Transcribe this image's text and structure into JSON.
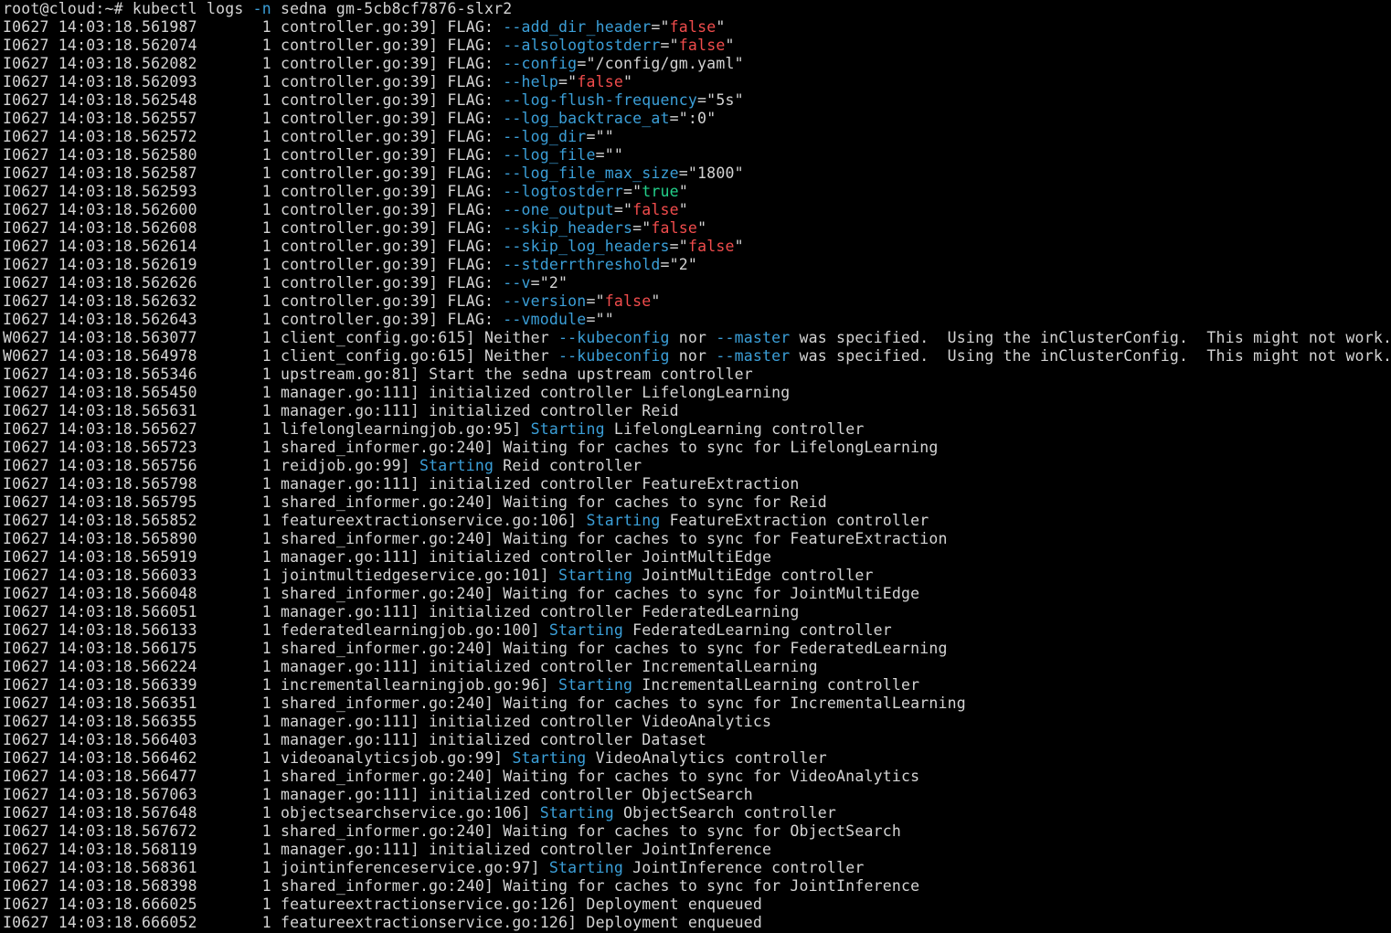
{
  "terminal": {
    "prompt": "root@cloud:~# ",
    "command": {
      "prog": "kubectl logs ",
      "flag": "-n",
      "rest": " sedna gm-5cb8cf7876-slxr2"
    },
    "colors": {
      "background": "#000000",
      "text": "#d4d4d4",
      "flag": "#3b9fd8",
      "false": "#f14c4c",
      "true": "#23d18b"
    },
    "lines": [
      [
        {
          "t": "I0627 14:03:18.561987       1 controller.go:39] FLAG: ",
          "c": "plain"
        },
        {
          "t": "--add_dir_header",
          "c": "flag"
        },
        {
          "t": "=\"",
          "c": "plain"
        },
        {
          "t": "false",
          "c": "bool"
        },
        {
          "t": "\"",
          "c": "plain"
        }
      ],
      [
        {
          "t": "I0627 14:03:18.562074       1 controller.go:39] FLAG: ",
          "c": "plain"
        },
        {
          "t": "--alsologtostderr",
          "c": "flag"
        },
        {
          "t": "=\"",
          "c": "plain"
        },
        {
          "t": "false",
          "c": "bool"
        },
        {
          "t": "\"",
          "c": "plain"
        }
      ],
      [
        {
          "t": "I0627 14:03:18.562082       1 controller.go:39] FLAG: ",
          "c": "plain"
        },
        {
          "t": "--config",
          "c": "flag"
        },
        {
          "t": "=\"/config/gm.yaml\"",
          "c": "plain"
        }
      ],
      [
        {
          "t": "I0627 14:03:18.562093       1 controller.go:39] FLAG: ",
          "c": "plain"
        },
        {
          "t": "--help",
          "c": "flag"
        },
        {
          "t": "=\"",
          "c": "plain"
        },
        {
          "t": "false",
          "c": "bool"
        },
        {
          "t": "\"",
          "c": "plain"
        }
      ],
      [
        {
          "t": "I0627 14:03:18.562548       1 controller.go:39] FLAG: ",
          "c": "plain"
        },
        {
          "t": "--log-flush-frequency",
          "c": "flag"
        },
        {
          "t": "=\"5s\"",
          "c": "plain"
        }
      ],
      [
        {
          "t": "I0627 14:03:18.562557       1 controller.go:39] FLAG: ",
          "c": "plain"
        },
        {
          "t": "--log_backtrace_at",
          "c": "flag"
        },
        {
          "t": "=\":0\"",
          "c": "plain"
        }
      ],
      [
        {
          "t": "I0627 14:03:18.562572       1 controller.go:39] FLAG: ",
          "c": "plain"
        },
        {
          "t": "--log_dir",
          "c": "flag"
        },
        {
          "t": "=\"\"",
          "c": "plain"
        }
      ],
      [
        {
          "t": "I0627 14:03:18.562580       1 controller.go:39] FLAG: ",
          "c": "plain"
        },
        {
          "t": "--log_file",
          "c": "flag"
        },
        {
          "t": "=\"\"",
          "c": "plain"
        }
      ],
      [
        {
          "t": "I0627 14:03:18.562587       1 controller.go:39] FLAG: ",
          "c": "plain"
        },
        {
          "t": "--log_file_max_size",
          "c": "flag"
        },
        {
          "t": "=\"1800\"",
          "c": "plain"
        }
      ],
      [
        {
          "t": "I0627 14:03:18.562593       1 controller.go:39] FLAG: ",
          "c": "plain"
        },
        {
          "t": "--logtostderr",
          "c": "flag"
        },
        {
          "t": "=\"",
          "c": "plain"
        },
        {
          "t": "true",
          "c": "true"
        },
        {
          "t": "\"",
          "c": "plain"
        }
      ],
      [
        {
          "t": "I0627 14:03:18.562600       1 controller.go:39] FLAG: ",
          "c": "plain"
        },
        {
          "t": "--one_output",
          "c": "flag"
        },
        {
          "t": "=\"",
          "c": "plain"
        },
        {
          "t": "false",
          "c": "bool"
        },
        {
          "t": "\"",
          "c": "plain"
        }
      ],
      [
        {
          "t": "I0627 14:03:18.562608       1 controller.go:39] FLAG: ",
          "c": "plain"
        },
        {
          "t": "--skip_headers",
          "c": "flag"
        },
        {
          "t": "=\"",
          "c": "plain"
        },
        {
          "t": "false",
          "c": "bool"
        },
        {
          "t": "\"",
          "c": "plain"
        }
      ],
      [
        {
          "t": "I0627 14:03:18.562614       1 controller.go:39] FLAG: ",
          "c": "plain"
        },
        {
          "t": "--skip_log_headers",
          "c": "flag"
        },
        {
          "t": "=\"",
          "c": "plain"
        },
        {
          "t": "false",
          "c": "bool"
        },
        {
          "t": "\"",
          "c": "plain"
        }
      ],
      [
        {
          "t": "I0627 14:03:18.562619       1 controller.go:39] FLAG: ",
          "c": "plain"
        },
        {
          "t": "--stderrthreshold",
          "c": "flag"
        },
        {
          "t": "=\"2\"",
          "c": "plain"
        }
      ],
      [
        {
          "t": "I0627 14:03:18.562626       1 controller.go:39] FLAG: ",
          "c": "plain"
        },
        {
          "t": "--v",
          "c": "flag"
        },
        {
          "t": "=\"2\"",
          "c": "plain"
        }
      ],
      [
        {
          "t": "I0627 14:03:18.562632       1 controller.go:39] FLAG: ",
          "c": "plain"
        },
        {
          "t": "--version",
          "c": "flag"
        },
        {
          "t": "=\"",
          "c": "plain"
        },
        {
          "t": "false",
          "c": "bool"
        },
        {
          "t": "\"",
          "c": "plain"
        }
      ],
      [
        {
          "t": "I0627 14:03:18.562643       1 controller.go:39] FLAG: ",
          "c": "plain"
        },
        {
          "t": "--vmodule",
          "c": "flag"
        },
        {
          "t": "=\"\"",
          "c": "plain"
        }
      ],
      [
        {
          "t": "W0627 14:03:18.563077       1 client_config.go:615] Neither ",
          "c": "plain"
        },
        {
          "t": "--kubeconfig",
          "c": "flag"
        },
        {
          "t": " nor ",
          "c": "plain"
        },
        {
          "t": "--master",
          "c": "flag"
        },
        {
          "t": " was specified.  Using the inClusterConfig.  This might not work.",
          "c": "plain"
        }
      ],
      [
        {
          "t": "W0627 14:03:18.564978       1 client_config.go:615] Neither ",
          "c": "plain"
        },
        {
          "t": "--kubeconfig",
          "c": "flag"
        },
        {
          "t": " nor ",
          "c": "plain"
        },
        {
          "t": "--master",
          "c": "flag"
        },
        {
          "t": " was specified.  Using the inClusterConfig.  This might not work.",
          "c": "plain"
        }
      ],
      [
        {
          "t": "I0627 14:03:18.565346       1 upstream.go:81] Start the sedna upstream controller",
          "c": "plain"
        }
      ],
      [
        {
          "t": "I0627 14:03:18.565450       1 manager.go:111] initialized controller LifelongLearning",
          "c": "plain"
        }
      ],
      [
        {
          "t": "I0627 14:03:18.565631       1 manager.go:111] initialized controller Reid",
          "c": "plain"
        }
      ],
      [
        {
          "t": "I0627 14:03:18.565627       1 lifelonglearningjob.go:95] ",
          "c": "plain"
        },
        {
          "t": "Starting",
          "c": "starting"
        },
        {
          "t": " LifelongLearning controller",
          "c": "plain"
        }
      ],
      [
        {
          "t": "I0627 14:03:18.565723       1 shared_informer.go:240] Waiting for caches to sync for LifelongLearning",
          "c": "plain"
        }
      ],
      [
        {
          "t": "I0627 14:03:18.565756       1 reidjob.go:99] ",
          "c": "plain"
        },
        {
          "t": "Starting",
          "c": "starting"
        },
        {
          "t": " Reid controller",
          "c": "plain"
        }
      ],
      [
        {
          "t": "I0627 14:03:18.565798       1 manager.go:111] initialized controller FeatureExtraction",
          "c": "plain"
        }
      ],
      [
        {
          "t": "I0627 14:03:18.565795       1 shared_informer.go:240] Waiting for caches to sync for Reid",
          "c": "plain"
        }
      ],
      [
        {
          "t": "I0627 14:03:18.565852       1 featureextractionservice.go:106] ",
          "c": "plain"
        },
        {
          "t": "Starting",
          "c": "starting"
        },
        {
          "t": " FeatureExtraction controller",
          "c": "plain"
        }
      ],
      [
        {
          "t": "I0627 14:03:18.565890       1 shared_informer.go:240] Waiting for caches to sync for FeatureExtraction",
          "c": "plain"
        }
      ],
      [
        {
          "t": "I0627 14:03:18.565919       1 manager.go:111] initialized controller JointMultiEdge",
          "c": "plain"
        }
      ],
      [
        {
          "t": "I0627 14:03:18.566033       1 jointmultiedgeservice.go:101] ",
          "c": "plain"
        },
        {
          "t": "Starting",
          "c": "starting"
        },
        {
          "t": " JointMultiEdge controller",
          "c": "plain"
        }
      ],
      [
        {
          "t": "I0627 14:03:18.566048       1 shared_informer.go:240] Waiting for caches to sync for JointMultiEdge",
          "c": "plain"
        }
      ],
      [
        {
          "t": "I0627 14:03:18.566051       1 manager.go:111] initialized controller FederatedLearning",
          "c": "plain"
        }
      ],
      [
        {
          "t": "I0627 14:03:18.566133       1 federatedlearningjob.go:100] ",
          "c": "plain"
        },
        {
          "t": "Starting",
          "c": "starting"
        },
        {
          "t": " FederatedLearning controller",
          "c": "plain"
        }
      ],
      [
        {
          "t": "I0627 14:03:18.566175       1 shared_informer.go:240] Waiting for caches to sync for FederatedLearning",
          "c": "plain"
        }
      ],
      [
        {
          "t": "I0627 14:03:18.566224       1 manager.go:111] initialized controller IncrementalLearning",
          "c": "plain"
        }
      ],
      [
        {
          "t": "I0627 14:03:18.566339       1 incrementallearningjob.go:96] ",
          "c": "plain"
        },
        {
          "t": "Starting",
          "c": "starting"
        },
        {
          "t": " IncrementalLearning controller",
          "c": "plain"
        }
      ],
      [
        {
          "t": "I0627 14:03:18.566351       1 shared_informer.go:240] Waiting for caches to sync for IncrementalLearning",
          "c": "plain"
        }
      ],
      [
        {
          "t": "I0627 14:03:18.566355       1 manager.go:111] initialized controller VideoAnalytics",
          "c": "plain"
        }
      ],
      [
        {
          "t": "I0627 14:03:18.566403       1 manager.go:111] initialized controller Dataset",
          "c": "plain"
        }
      ],
      [
        {
          "t": "I0627 14:03:18.566462       1 videoanalyticsjob.go:99] ",
          "c": "plain"
        },
        {
          "t": "Starting",
          "c": "starting"
        },
        {
          "t": " VideoAnalytics controller",
          "c": "plain"
        }
      ],
      [
        {
          "t": "I0627 14:03:18.566477       1 shared_informer.go:240] Waiting for caches to sync for VideoAnalytics",
          "c": "plain"
        }
      ],
      [
        {
          "t": "I0627 14:03:18.567063       1 manager.go:111] initialized controller ObjectSearch",
          "c": "plain"
        }
      ],
      [
        {
          "t": "I0627 14:03:18.567648       1 objectsearchservice.go:106] ",
          "c": "plain"
        },
        {
          "t": "Starting",
          "c": "starting"
        },
        {
          "t": " ObjectSearch controller",
          "c": "plain"
        }
      ],
      [
        {
          "t": "I0627 14:03:18.567672       1 shared_informer.go:240] Waiting for caches to sync for ObjectSearch",
          "c": "plain"
        }
      ],
      [
        {
          "t": "I0627 14:03:18.568119       1 manager.go:111] initialized controller JointInference",
          "c": "plain"
        }
      ],
      [
        {
          "t": "I0627 14:03:18.568361       1 jointinferenceservice.go:97] ",
          "c": "plain"
        },
        {
          "t": "Starting",
          "c": "starting"
        },
        {
          "t": " JointInference controller",
          "c": "plain"
        }
      ],
      [
        {
          "t": "I0627 14:03:18.568398       1 shared_informer.go:240] Waiting for caches to sync for JointInference",
          "c": "plain"
        }
      ],
      [
        {
          "t": "I0627 14:03:18.666025       1 featureextractionservice.go:126] Deployment enqueued",
          "c": "plain"
        }
      ],
      [
        {
          "t": "I0627 14:03:18.666052       1 featureextractionservice.go:126] Deployment enqueued",
          "c": "plain"
        }
      ]
    ]
  }
}
